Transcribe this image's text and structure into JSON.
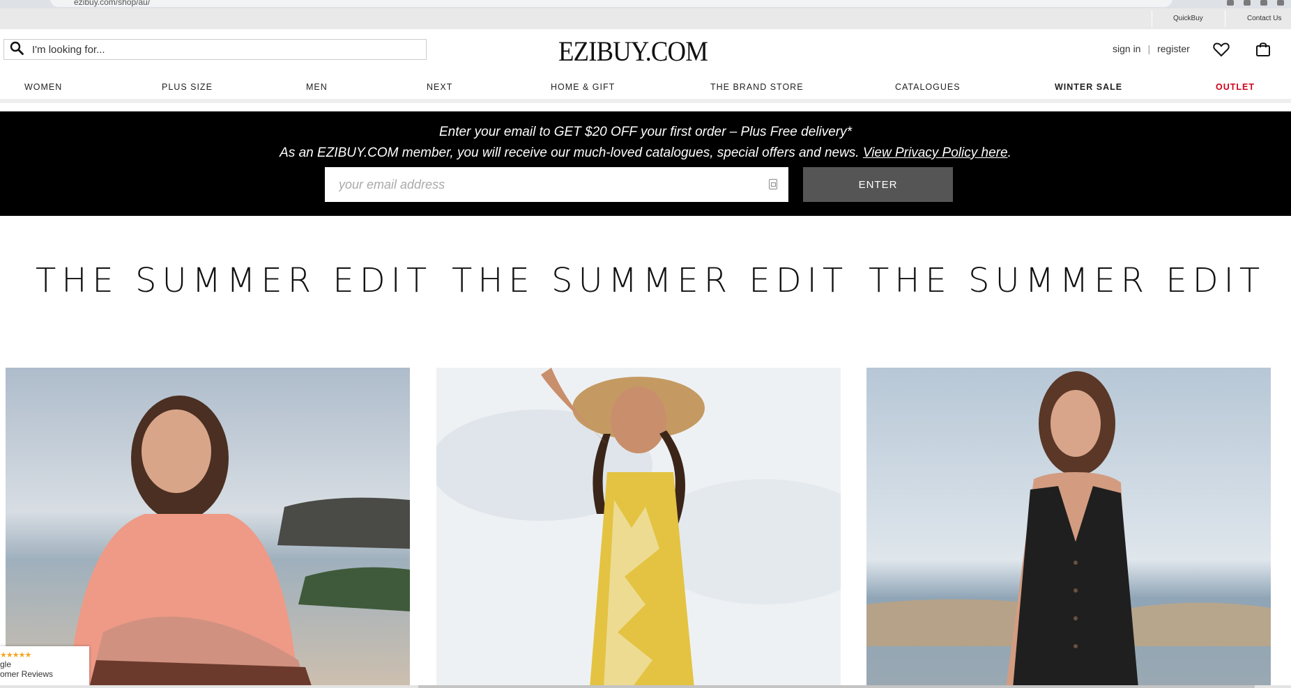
{
  "browser": {
    "url": "ezibuy.com/shop/au/"
  },
  "utility": {
    "quickbuy": "QuickBuy",
    "contact": "Contact Us"
  },
  "header": {
    "search_placeholder": "I'm looking for...",
    "logo": "EZIBUY.COM",
    "sign_in": "sign in",
    "separator": "|",
    "register": "register",
    "icons": [
      "search-icon",
      "heart-icon",
      "bag-icon"
    ]
  },
  "nav": {
    "items": [
      "WOMEN",
      "PLUS SIZE",
      "MEN",
      "NEXT",
      "HOME & GIFT",
      "THE BRAND STORE",
      "CATALOGUES",
      "WINTER SALE",
      "OUTLET"
    ],
    "outlet_color": "#d0021b"
  },
  "promo": {
    "line1": "Enter your email to GET $20 OFF your first order – Plus Free delivery*",
    "line2": "As an EZIBUY.COM member, you will receive our much-loved catalogues, special offers and news. ",
    "privacy_link": "View Privacy Policy here",
    "period": ".",
    "email_placeholder": "your email address",
    "enter": "ENTER"
  },
  "editorial": {
    "titles": [
      "THE SUMMER EDIT",
      "THE SUMMER EDIT",
      "THE SUMMER EDIT"
    ]
  },
  "reviews_badge": {
    "stars": "★★★★★",
    "line1": "gle",
    "line2": "omer Reviews"
  }
}
